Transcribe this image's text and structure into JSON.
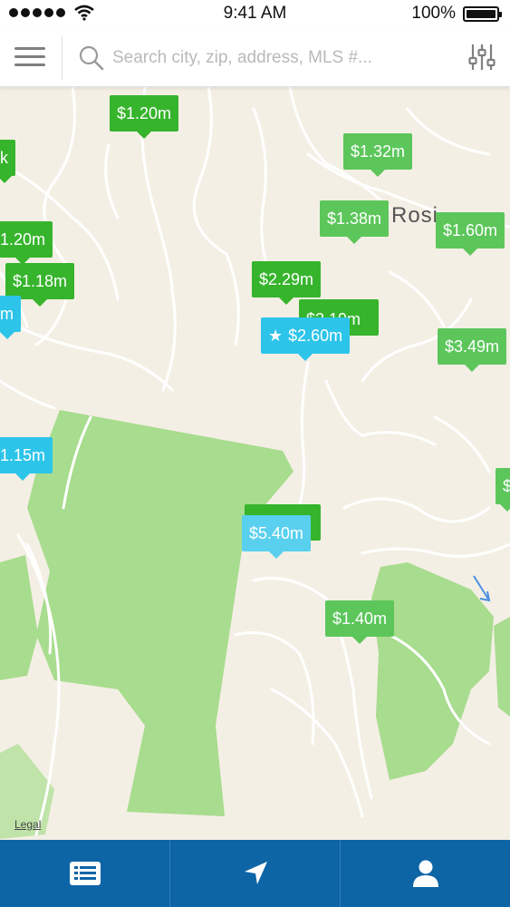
{
  "status_bar": {
    "time": "9:41 AM",
    "battery": "100%"
  },
  "search": {
    "placeholder": "Search city, zip, address, MLS #..."
  },
  "map": {
    "area_label": "Rosi",
    "legal_label": "Legal",
    "pins": [
      {
        "price": "$1.20m",
        "style": "dark",
        "starred": false
      },
      {
        "price": "k",
        "style": "dark",
        "starred": false
      },
      {
        "price": "$1.32m",
        "style": "light",
        "starred": false
      },
      {
        "price": "$1.38m",
        "style": "light",
        "starred": false
      },
      {
        "price": "$1.60m",
        "style": "light",
        "starred": false
      },
      {
        "price": "1.20m",
        "style": "dark",
        "starred": false
      },
      {
        "price": "$1.18m",
        "style": "dark",
        "starred": false
      },
      {
        "price": "m",
        "style": "blue",
        "starred": false
      },
      {
        "price": "$2.29m",
        "style": "dark",
        "starred": false
      },
      {
        "price": "$2.19m",
        "style": "dark",
        "starred": false
      },
      {
        "price": "$2.60m",
        "style": "blue",
        "starred": true
      },
      {
        "price": "$3.49m",
        "style": "light",
        "starred": false
      },
      {
        "price": "1.15m",
        "style": "blue",
        "starred": false
      },
      {
        "price": "",
        "style": "dark",
        "starred": false
      },
      {
        "price": "$5.40m",
        "style": "blue-light",
        "starred": false
      },
      {
        "price": "$1.40m",
        "style": "light",
        "starred": false
      },
      {
        "price": "$",
        "style": "light",
        "starred": false
      }
    ]
  },
  "tabs": [
    {
      "icon": "list-icon"
    },
    {
      "icon": "location-arrow-icon"
    },
    {
      "icon": "user-icon"
    }
  ],
  "colors": {
    "pin_dark": "#36b42c",
    "pin_light": "#5cc65b",
    "pin_blue": "#2dc4ea",
    "tab_bar": "#0d65a6",
    "park": "#a8dc8e"
  }
}
